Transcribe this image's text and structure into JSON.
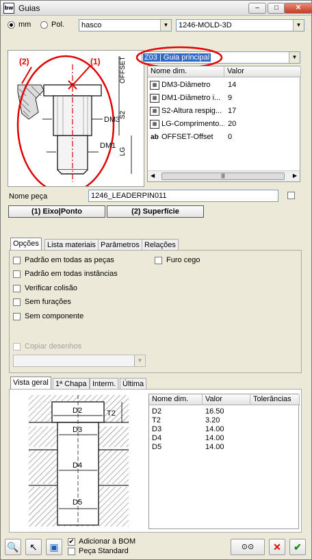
{
  "window": {
    "title": "Guias",
    "app_icon": "bw",
    "buttons": {
      "minimize": "–",
      "maximize": "□",
      "close": "✕"
    }
  },
  "units": {
    "mm_label": "mm",
    "pol_label": "Pol.",
    "selected": "mm"
  },
  "supplier_combo": {
    "value": "hasco"
  },
  "catalog_combo": {
    "value": "1246-MOLD-3D"
  },
  "type_combo": {
    "value": "Z03 | Guia principal"
  },
  "drawing_labels": {
    "callout_1": "(1)",
    "callout_2": "(2)",
    "offset": "OFFSET",
    "s2": "S2",
    "dm3": "DM3",
    "dm1": "DM1",
    "lg": "LG"
  },
  "dim_table": {
    "headers": [
      "Nome dim.",
      "Valor"
    ],
    "rows": [
      {
        "icon": "table-icon",
        "name": "DM3-Diâmetro",
        "value": "14"
      },
      {
        "icon": "table-icon",
        "name": "DM1-Diâmetro i...",
        "value": "9"
      },
      {
        "icon": "table-icon",
        "name": "S2-Altura respig...",
        "value": "17"
      },
      {
        "icon": "table-icon",
        "name": "LG-Comprimento...",
        "value": "20"
      },
      {
        "icon": "text-field-icon",
        "icon_text": "ab",
        "name": "OFFSET-Offset",
        "value": "0"
      }
    ]
  },
  "part_name": {
    "label": "Nome peça",
    "value": "1246_LEADERPIN011"
  },
  "buttons": {
    "axis_point": "(1) Eixo|Ponto",
    "surface": "(2) Superfície"
  },
  "options_tabs": [
    "Opções",
    "Lista materiais",
    "Parâmetros",
    "Relações"
  ],
  "options": {
    "padrao_todas_pecas": "Padrão em todas as peças",
    "padrao_todas_instancias": "Padrão em todas instâncias",
    "verificar_colisao": "Verificar colisão",
    "sem_furacoes": "Sem furações",
    "sem_componente": "Sem componente",
    "furo_cego": "Furo cego",
    "copiar_desenhos": "Copiar desenhos"
  },
  "view_tabs": [
    "Vista geral",
    "1ª Chapa",
    "Interm.",
    "Última"
  ],
  "view_drawing_labels": {
    "d2": "D2",
    "t2": "T2",
    "d3": "D3",
    "d4": "D4",
    "d5": "D5"
  },
  "view_table": {
    "headers": [
      "Nome dim.",
      "Valor",
      "Tolerâncias"
    ],
    "rows": [
      {
        "name": "D2",
        "value": "16.50"
      },
      {
        "name": "T2",
        "value": "3.20"
      },
      {
        "name": "D3",
        "value": "14.00"
      },
      {
        "name": "D4",
        "value": "14.00"
      },
      {
        "name": "D5",
        "value": "14.00"
      }
    ]
  },
  "bom": {
    "add_label": "Adicionar à BOM",
    "standard_label": "Peça Standard",
    "add_checked": "✔"
  },
  "bottom_buttons": {
    "glasses": "⊙⊙",
    "cancel": "✕",
    "ok": "✔"
  }
}
